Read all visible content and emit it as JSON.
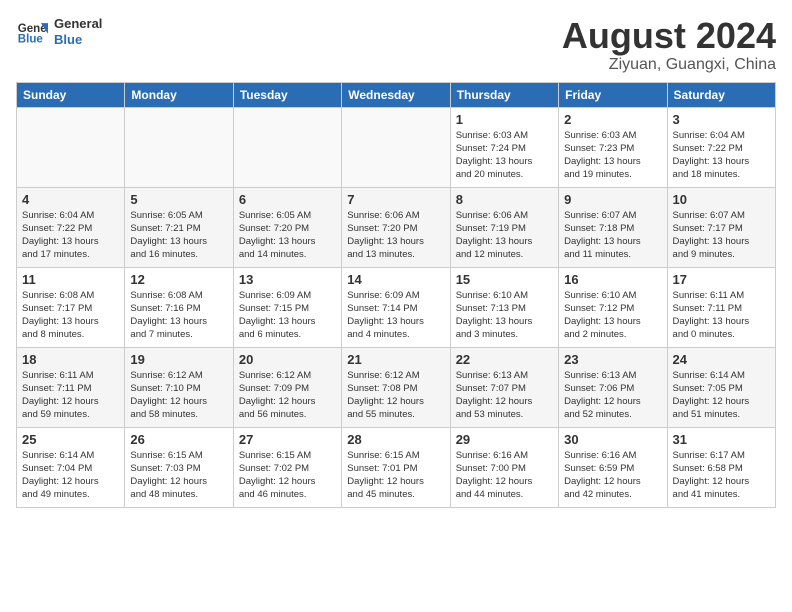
{
  "logo": {
    "text_general": "General",
    "text_blue": "Blue"
  },
  "title": {
    "month_year": "August 2024",
    "location": "Ziyuan, Guangxi, China"
  },
  "days_of_week": [
    "Sunday",
    "Monday",
    "Tuesday",
    "Wednesday",
    "Thursday",
    "Friday",
    "Saturday"
  ],
  "weeks": [
    [
      {
        "day": "",
        "info": ""
      },
      {
        "day": "",
        "info": ""
      },
      {
        "day": "",
        "info": ""
      },
      {
        "day": "",
        "info": ""
      },
      {
        "day": "1",
        "info": "Sunrise: 6:03 AM\nSunset: 7:24 PM\nDaylight: 13 hours\nand 20 minutes."
      },
      {
        "day": "2",
        "info": "Sunrise: 6:03 AM\nSunset: 7:23 PM\nDaylight: 13 hours\nand 19 minutes."
      },
      {
        "day": "3",
        "info": "Sunrise: 6:04 AM\nSunset: 7:22 PM\nDaylight: 13 hours\nand 18 minutes."
      }
    ],
    [
      {
        "day": "4",
        "info": "Sunrise: 6:04 AM\nSunset: 7:22 PM\nDaylight: 13 hours\nand 17 minutes."
      },
      {
        "day": "5",
        "info": "Sunrise: 6:05 AM\nSunset: 7:21 PM\nDaylight: 13 hours\nand 16 minutes."
      },
      {
        "day": "6",
        "info": "Sunrise: 6:05 AM\nSunset: 7:20 PM\nDaylight: 13 hours\nand 14 minutes."
      },
      {
        "day": "7",
        "info": "Sunrise: 6:06 AM\nSunset: 7:20 PM\nDaylight: 13 hours\nand 13 minutes."
      },
      {
        "day": "8",
        "info": "Sunrise: 6:06 AM\nSunset: 7:19 PM\nDaylight: 13 hours\nand 12 minutes."
      },
      {
        "day": "9",
        "info": "Sunrise: 6:07 AM\nSunset: 7:18 PM\nDaylight: 13 hours\nand 11 minutes."
      },
      {
        "day": "10",
        "info": "Sunrise: 6:07 AM\nSunset: 7:17 PM\nDaylight: 13 hours\nand 9 minutes."
      }
    ],
    [
      {
        "day": "11",
        "info": "Sunrise: 6:08 AM\nSunset: 7:17 PM\nDaylight: 13 hours\nand 8 minutes."
      },
      {
        "day": "12",
        "info": "Sunrise: 6:08 AM\nSunset: 7:16 PM\nDaylight: 13 hours\nand 7 minutes."
      },
      {
        "day": "13",
        "info": "Sunrise: 6:09 AM\nSunset: 7:15 PM\nDaylight: 13 hours\nand 6 minutes."
      },
      {
        "day": "14",
        "info": "Sunrise: 6:09 AM\nSunset: 7:14 PM\nDaylight: 13 hours\nand 4 minutes."
      },
      {
        "day": "15",
        "info": "Sunrise: 6:10 AM\nSunset: 7:13 PM\nDaylight: 13 hours\nand 3 minutes."
      },
      {
        "day": "16",
        "info": "Sunrise: 6:10 AM\nSunset: 7:12 PM\nDaylight: 13 hours\nand 2 minutes."
      },
      {
        "day": "17",
        "info": "Sunrise: 6:11 AM\nSunset: 7:11 PM\nDaylight: 13 hours\nand 0 minutes."
      }
    ],
    [
      {
        "day": "18",
        "info": "Sunrise: 6:11 AM\nSunset: 7:11 PM\nDaylight: 12 hours\nand 59 minutes."
      },
      {
        "day": "19",
        "info": "Sunrise: 6:12 AM\nSunset: 7:10 PM\nDaylight: 12 hours\nand 58 minutes."
      },
      {
        "day": "20",
        "info": "Sunrise: 6:12 AM\nSunset: 7:09 PM\nDaylight: 12 hours\nand 56 minutes."
      },
      {
        "day": "21",
        "info": "Sunrise: 6:12 AM\nSunset: 7:08 PM\nDaylight: 12 hours\nand 55 minutes."
      },
      {
        "day": "22",
        "info": "Sunrise: 6:13 AM\nSunset: 7:07 PM\nDaylight: 12 hours\nand 53 minutes."
      },
      {
        "day": "23",
        "info": "Sunrise: 6:13 AM\nSunset: 7:06 PM\nDaylight: 12 hours\nand 52 minutes."
      },
      {
        "day": "24",
        "info": "Sunrise: 6:14 AM\nSunset: 7:05 PM\nDaylight: 12 hours\nand 51 minutes."
      }
    ],
    [
      {
        "day": "25",
        "info": "Sunrise: 6:14 AM\nSunset: 7:04 PM\nDaylight: 12 hours\nand 49 minutes."
      },
      {
        "day": "26",
        "info": "Sunrise: 6:15 AM\nSunset: 7:03 PM\nDaylight: 12 hours\nand 48 minutes."
      },
      {
        "day": "27",
        "info": "Sunrise: 6:15 AM\nSunset: 7:02 PM\nDaylight: 12 hours\nand 46 minutes."
      },
      {
        "day": "28",
        "info": "Sunrise: 6:15 AM\nSunset: 7:01 PM\nDaylight: 12 hours\nand 45 minutes."
      },
      {
        "day": "29",
        "info": "Sunrise: 6:16 AM\nSunset: 7:00 PM\nDaylight: 12 hours\nand 44 minutes."
      },
      {
        "day": "30",
        "info": "Sunrise: 6:16 AM\nSunset: 6:59 PM\nDaylight: 12 hours\nand 42 minutes."
      },
      {
        "day": "31",
        "info": "Sunrise: 6:17 AM\nSunset: 6:58 PM\nDaylight: 12 hours\nand 41 minutes."
      }
    ]
  ]
}
